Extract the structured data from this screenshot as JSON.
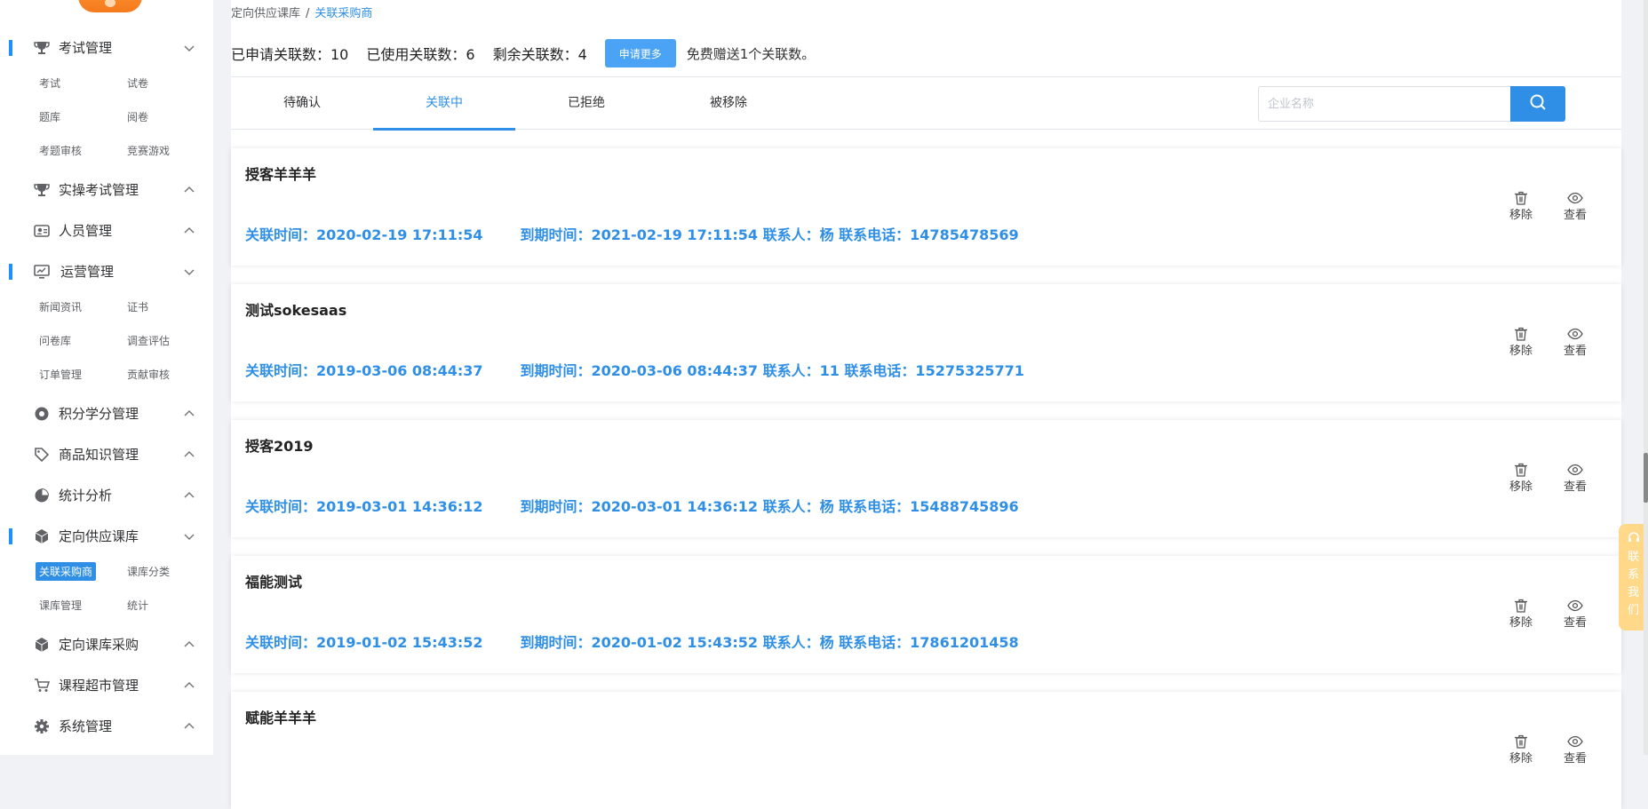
{
  "breadcrumb": {
    "parent": "定向供应课库",
    "current": "关联采购商"
  },
  "stats": {
    "applied": "已申请关联数：10",
    "used": "已使用关联数：6",
    "remaining": "剩余关联数：4",
    "apply_more_label": "申请更多",
    "gift_text": "免费赠送1个关联数。"
  },
  "tabs": [
    "待确认",
    "关联中",
    "已拒绝",
    "被移除"
  ],
  "active_tab": "关联中",
  "search": {
    "placeholder": "企业名称",
    "value": ""
  },
  "sidebar": {
    "groups": [
      {
        "label": "考试管理",
        "icon": "trophy-icon",
        "expanded": true,
        "items": [
          "考试",
          "试卷",
          "题库",
          "阅卷",
          "考题审核",
          "竞赛游戏"
        ]
      },
      {
        "label": "实操考试管理",
        "icon": "trophy-icon",
        "expanded": false
      },
      {
        "label": "人员管理",
        "icon": "user-card-icon",
        "expanded": false
      },
      {
        "label": "运营管理",
        "icon": "monitor-icon",
        "expanded": true,
        "items": [
          "新闻资讯",
          "证书",
          "问卷库",
          "调查评估",
          "订单管理",
          "贡献审核"
        ]
      },
      {
        "label": "积分学分管理",
        "icon": "coin-icon",
        "expanded": false
      },
      {
        "label": "商品知识管理",
        "icon": "tag-icon",
        "expanded": false
      },
      {
        "label": "统计分析",
        "icon": "pie-chart-icon",
        "expanded": false
      },
      {
        "label": "定向供应课库",
        "icon": "box-icon",
        "expanded": true,
        "items": [
          "关联采购商",
          "课库分类",
          "课库管理",
          "统计"
        ]
      },
      {
        "label": "定向课库采购",
        "icon": "box-icon",
        "expanded": false
      },
      {
        "label": "课程超市管理",
        "icon": "cart-icon",
        "expanded": false
      },
      {
        "label": "系统管理",
        "icon": "gear-icon",
        "expanded": false
      }
    ],
    "active_item": "关联采购商"
  },
  "cards": [
    {
      "name": "授客羊羊羊",
      "linked": "关联时间：2020-02-19 17:11:54",
      "details": "到期时间：2021-02-19 17:11:54 联系人：杨 联系电话：14785478569"
    },
    {
      "name": "测试sokesaas",
      "linked": "关联时间：2019-03-06 08:44:37",
      "details": "到期时间：2020-03-06 08:44:37 联系人：11 联系电话：15275325771"
    },
    {
      "name": "授客2019",
      "linked": "关联时间：2019-03-01 14:36:12",
      "details": "到期时间：2020-03-01 14:36:12 联系人：杨 联系电话：15488745896"
    },
    {
      "name": "福能测试",
      "linked": "关联时间：2019-01-02 15:43:52",
      "details": "到期时间：2020-01-02 15:43:52 联系人：杨 联系电话：17861201458"
    },
    {
      "name": "赋能羊羊羊",
      "linked": "",
      "details": ""
    }
  ],
  "actions": {
    "remove": "移除",
    "view": "查看"
  },
  "contact_float": [
    "联",
    "系",
    "我",
    "们"
  ],
  "colors": {
    "accent": "#2f8fe6",
    "button": "#4aa3f5",
    "contact": "#ffd88a"
  }
}
